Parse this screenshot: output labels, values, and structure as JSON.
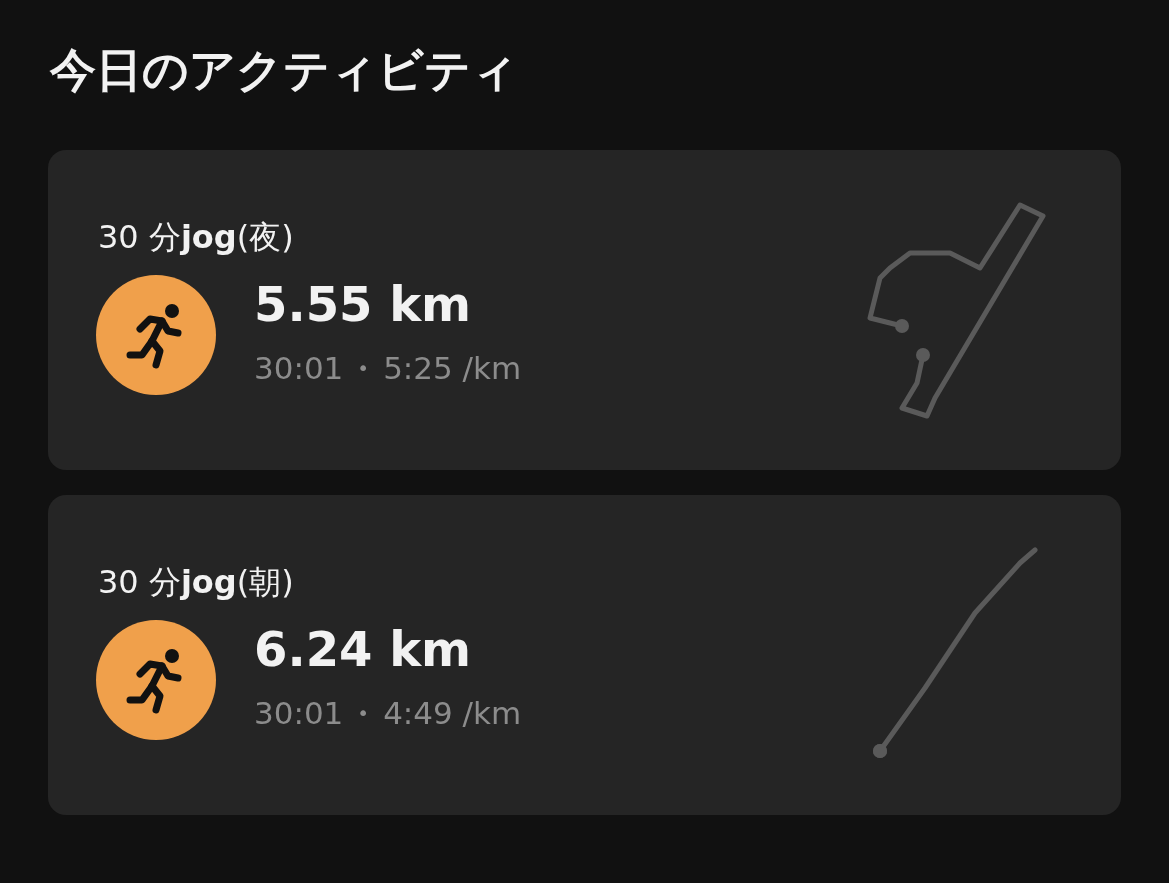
{
  "title": "今日のアクティビティ",
  "activities": [
    {
      "name": "30 分**jog**(夜)",
      "distance": "5.55 km",
      "duration": "30:01",
      "separator": "•",
      "pace": "5:25 /km"
    },
    {
      "name": "30 分**jog**(朝)",
      "distance": "6.24 km",
      "duration": "30:01",
      "separator": "•",
      "pace": "4:49 /km"
    }
  ]
}
